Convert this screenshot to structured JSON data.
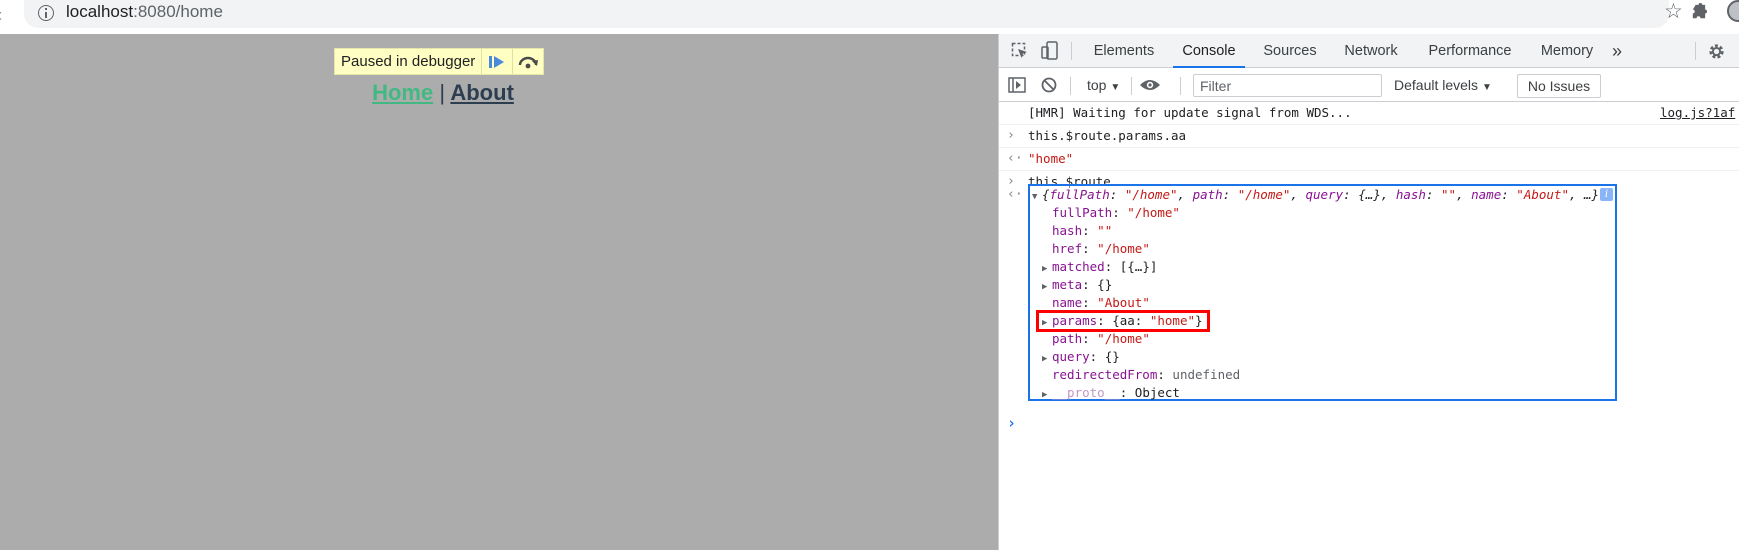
{
  "browser": {
    "url_host": "localhost",
    "url_path": ":8080/home"
  },
  "page": {
    "paused_text": "Paused in debugger",
    "nav": {
      "home": "Home",
      "separator": "|",
      "about": "About"
    }
  },
  "devtools": {
    "tabs": [
      "Elements",
      "Console",
      "Sources",
      "Network",
      "Performance",
      "Memory",
      "»"
    ],
    "active_tab": "Console",
    "toolbar": {
      "context": "top",
      "filter_placeholder": "Filter",
      "levels": "Default levels",
      "issues": "No Issues"
    }
  },
  "console": {
    "hmr_message": "[HMR] Waiting for update signal from WDS...",
    "hmr_source": "log.js?1af",
    "input1": "this.$route.params.aa",
    "output1": "\"home\"",
    "input2": "this.$route",
    "object_summary": {
      "open": "{",
      "k1": "fullPath",
      "v1": "\"/home\"",
      "k2": "path",
      "v2": "\"/home\"",
      "k3": "query",
      "v3": "{…}",
      "k4": "hash",
      "v4": "\"\"",
      "k5": "name",
      "v5": "\"About\"",
      "tail": ", …}"
    },
    "properties": [
      {
        "key": "fullPath",
        "value": "\"/home\"",
        "type": "string",
        "expandable": false
      },
      {
        "key": "hash",
        "value": "\"\"",
        "type": "string",
        "expandable": false
      },
      {
        "key": "href",
        "value": "\"/home\"",
        "type": "string",
        "expandable": false
      },
      {
        "key": "matched",
        "value": "[{…}]",
        "type": "plain",
        "expandable": true
      },
      {
        "key": "meta",
        "value": "{}",
        "type": "plain",
        "expandable": true
      },
      {
        "key": "name",
        "value": "\"About\"",
        "type": "string",
        "expandable": false
      },
      {
        "key": "params",
        "value": "{aa: \"home\"}",
        "type": "params",
        "expandable": true
      },
      {
        "key": "path",
        "value": "\"/home\"",
        "type": "string",
        "expandable": false
      },
      {
        "key": "query",
        "value": "{}",
        "type": "plain",
        "expandable": true
      },
      {
        "key": "redirectedFrom",
        "value": "undefined",
        "type": "undef",
        "expandable": false
      },
      {
        "key": "__proto__",
        "value": "Object",
        "type": "proto",
        "expandable": true
      }
    ]
  },
  "colors": {
    "page_bg": "#acacac",
    "highlight_box": "#ff0000",
    "selection_box": "#1a73e8",
    "string": "#c41a16",
    "property_key": "#881391"
  }
}
